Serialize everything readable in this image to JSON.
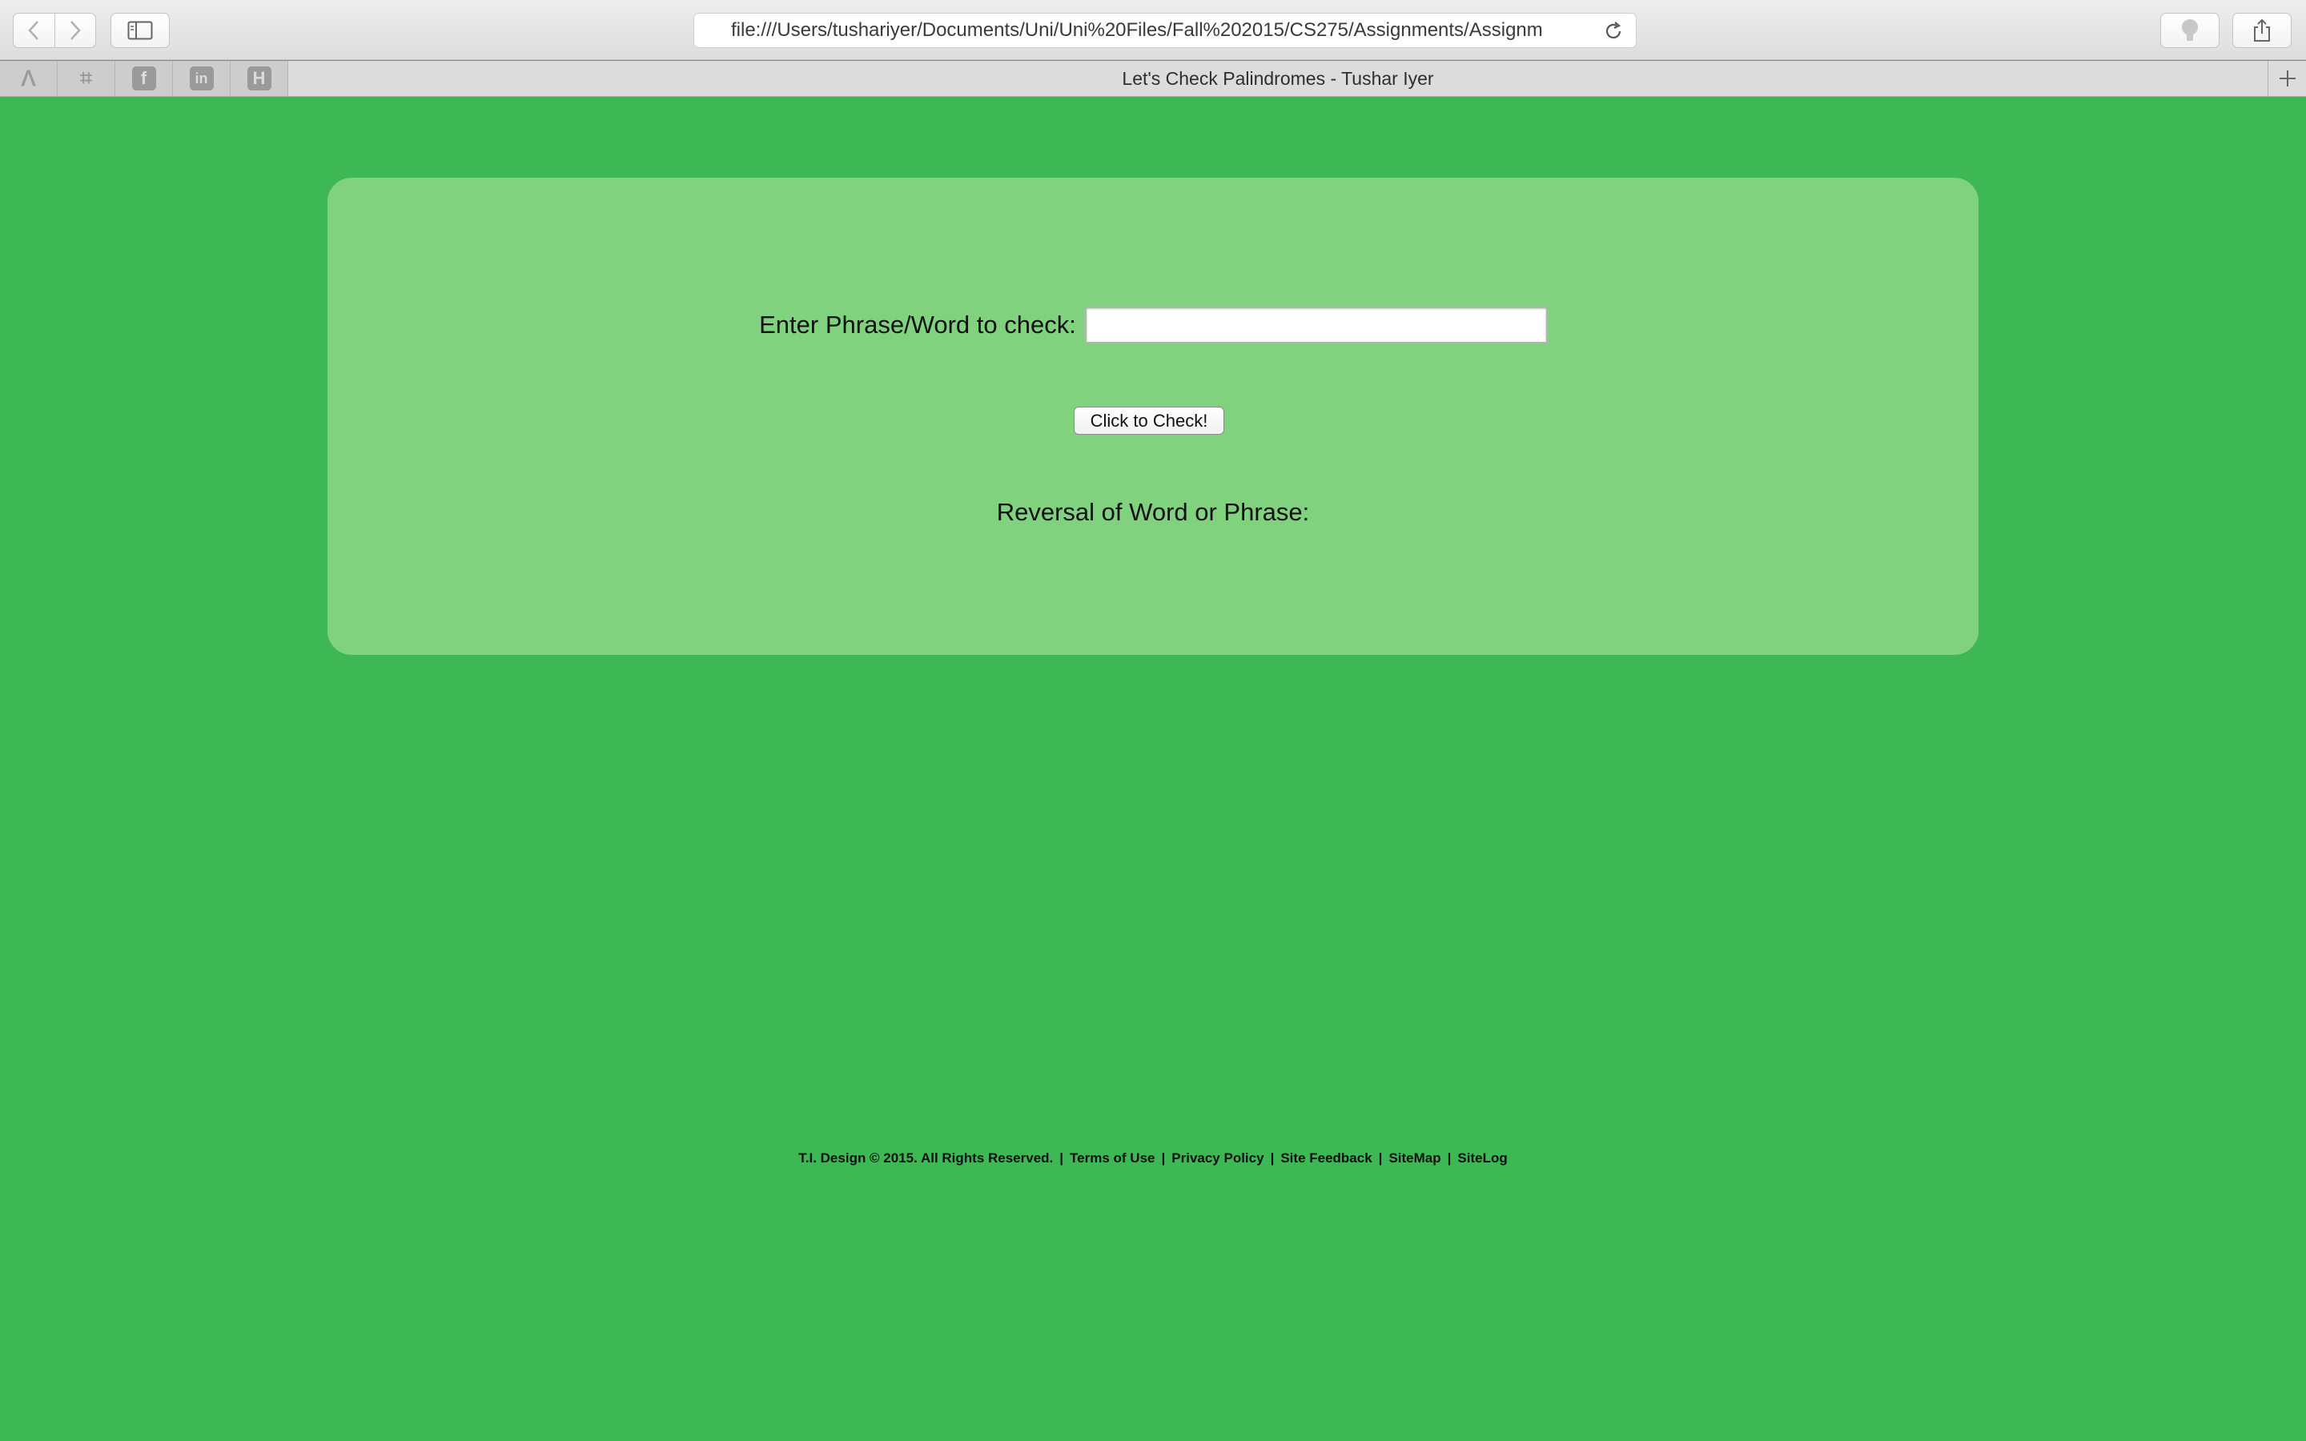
{
  "browser": {
    "url": "file:///Users/tushariyer/Documents/Uni/Uni%20Files/Fall%202015/CS275/Assignments/Assignm",
    "tab_title": "Let's Check Palindromes - Tushar Iyer",
    "favorites": [
      {
        "icon": "feedly-icon",
        "glyph": "ⴷ"
      },
      {
        "icon": "gift-icon",
        "glyph": "⌗"
      },
      {
        "icon": "facebook-icon",
        "glyph": "f"
      },
      {
        "icon": "linkedin-icon",
        "glyph": "in"
      },
      {
        "icon": "h-icon",
        "glyph": "H"
      }
    ]
  },
  "form": {
    "input_label": "Enter Phrase/Word to check:",
    "input_value": "",
    "button_label": "Click to Check!",
    "reversal_label": "Reversal of Word or Phrase:"
  },
  "footer": {
    "copyright": "T.I. Design © 2015. All Rights Reserved.",
    "links": [
      "Terms of Use",
      "Privacy Policy",
      "Site Feedback",
      "SiteMap",
      "SiteLog"
    ],
    "separator": "|"
  },
  "colors": {
    "page_background": "#3db855",
    "panel_background": "#80d27f"
  }
}
